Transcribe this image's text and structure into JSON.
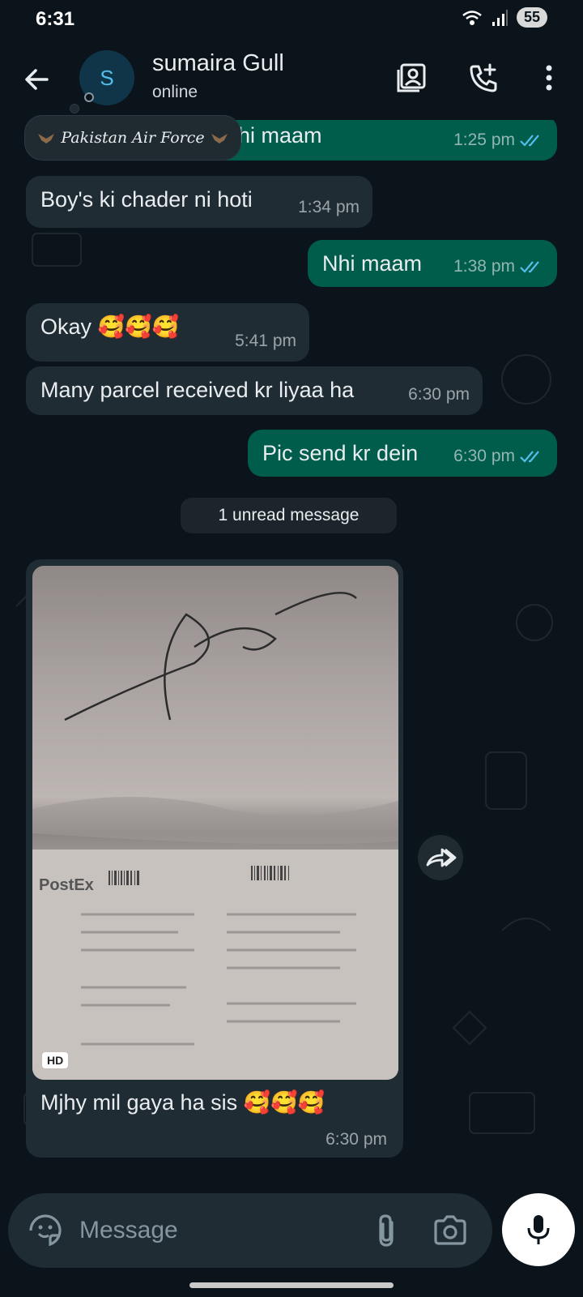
{
  "status_bar": {
    "time": "6:31",
    "battery": "55"
  },
  "header": {
    "avatar_letter": "S",
    "contact_name": "sumaira Gull",
    "status": "online"
  },
  "channel_chip": {
    "text": "Pakistan Air Force"
  },
  "messages": [
    {
      "dir": "out",
      "text": "hi maam",
      "time": "1:25 pm"
    },
    {
      "dir": "in",
      "text": "Boy's ki chader ni hoti",
      "time": "1:34 pm"
    },
    {
      "dir": "out",
      "text": "Nhi maam",
      "time": "1:38 pm"
    },
    {
      "dir": "in",
      "text": "Okay 🥰🥰🥰",
      "time": "5:41 pm"
    },
    {
      "dir": "in",
      "text": "Many parcel received kr liyaa ha",
      "time": "6:30 pm"
    },
    {
      "dir": "out",
      "text": "Pic send kr dein",
      "time": "6:30 pm"
    }
  ],
  "unread_label": "1 unread message",
  "image_message": {
    "badge": "HD",
    "caption": "Mjhy mil gaya ha sis 🥰🥰🥰",
    "time": "6:30 pm"
  },
  "composer": {
    "placeholder": "Message"
  },
  "colors": {
    "background": "#0b141a",
    "incoming": "#202c33",
    "outgoing": "#005c4b",
    "read_ticks": "#53bdeb"
  },
  "icons": [
    "back-arrow-icon",
    "contact-card-icon",
    "add-call-icon",
    "more-icon",
    "forward-icon",
    "sticker-icon",
    "attach-icon",
    "camera-icon",
    "mic-icon"
  ]
}
